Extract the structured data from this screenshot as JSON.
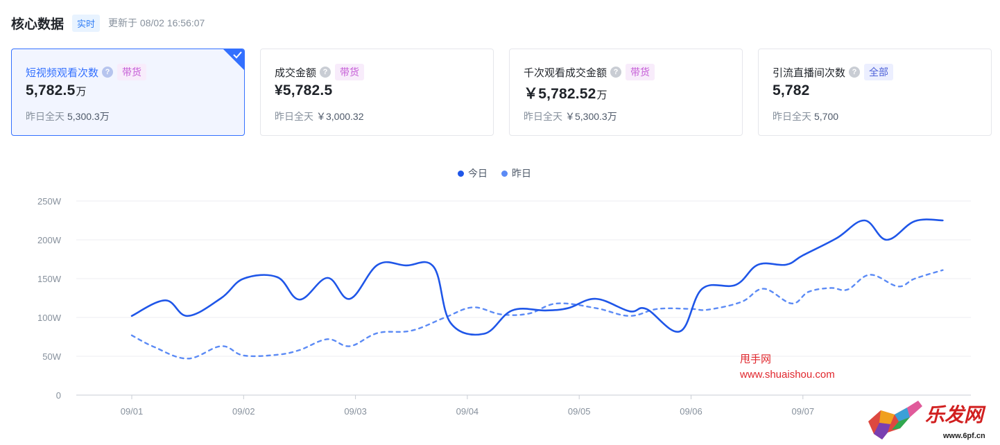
{
  "header": {
    "title": "核心数据",
    "realtime_badge": "实时",
    "update_text": "更新于 08/02 16:56:07"
  },
  "cards": [
    {
      "label": "短视频观看次数",
      "tag": "带货",
      "value": "5,782.5",
      "unit": "万",
      "compare_label": "昨日全天",
      "compare_value": "5,300.3万",
      "selected": true
    },
    {
      "label": "成交金额",
      "tag": "带货",
      "value": "¥5,782.5",
      "unit": "",
      "compare_label": "昨日全天",
      "compare_value": "￥3,000.32",
      "selected": false
    },
    {
      "label": "千次观看成交金额",
      "tag": "带货",
      "value": "￥5,782.52",
      "unit": "万",
      "compare_label": "昨日全天",
      "compare_value": "￥5,300.3万",
      "selected": false
    },
    {
      "label": "引流直播间次数",
      "tag": "全部",
      "value": "5,782",
      "unit": "",
      "compare_label": "昨日全天",
      "compare_value": "5,700",
      "selected": false
    }
  ],
  "legend": {
    "today": "今日",
    "yesterday": "昨日"
  },
  "colors": {
    "today": "#1f56e8",
    "yesterday": "#5b8af5",
    "selected_border": "#3370ff",
    "grid": "#e5e6eb"
  },
  "icons": {
    "help": "question-circle-icon",
    "check": "check-icon"
  },
  "chart_data": {
    "type": "line",
    "x_ticks": [
      "09/01",
      "09/02",
      "09/03",
      "09/04",
      "09/05",
      "09/06",
      "09/07"
    ],
    "y_ticks": [
      "0",
      "50W",
      "100W",
      "150W",
      "200W",
      "250W"
    ],
    "ylim": [
      0,
      250
    ],
    "series": [
      {
        "name": "今日",
        "style": "solid",
        "values": [
          [
            1.0,
            102
          ],
          [
            1.3,
            122
          ],
          [
            1.5,
            102
          ],
          [
            1.8,
            125
          ],
          [
            2.0,
            150
          ],
          [
            2.3,
            152
          ],
          [
            2.5,
            123
          ],
          [
            2.75,
            151
          ],
          [
            2.95,
            124
          ],
          [
            3.2,
            168
          ],
          [
            3.45,
            167
          ],
          [
            3.7,
            165
          ],
          [
            3.85,
            93
          ],
          [
            4.15,
            79
          ],
          [
            4.4,
            109
          ],
          [
            4.7,
            109
          ],
          [
            4.9,
            112
          ],
          [
            5.15,
            124
          ],
          [
            5.45,
            108
          ],
          [
            5.6,
            111
          ],
          [
            5.9,
            82
          ],
          [
            6.1,
            137
          ],
          [
            6.4,
            142
          ],
          [
            6.6,
            168
          ],
          [
            6.85,
            168
          ],
          [
            7.0,
            180
          ],
          [
            7.3,
            202
          ],
          [
            7.55,
            225
          ],
          [
            7.75,
            200
          ],
          [
            8.0,
            224
          ],
          [
            8.25,
            225
          ]
        ]
      },
      {
        "name": "昨日",
        "style": "dashed",
        "values": [
          [
            1.0,
            77
          ],
          [
            1.2,
            62
          ],
          [
            1.5,
            47
          ],
          [
            1.8,
            63
          ],
          [
            2.0,
            51
          ],
          [
            2.3,
            52
          ],
          [
            2.5,
            58
          ],
          [
            2.75,
            72
          ],
          [
            2.95,
            63
          ],
          [
            3.2,
            80
          ],
          [
            3.5,
            83
          ],
          [
            3.8,
            100
          ],
          [
            4.05,
            113
          ],
          [
            4.3,
            104
          ],
          [
            4.55,
            105
          ],
          [
            4.8,
            118
          ],
          [
            5.15,
            112
          ],
          [
            5.45,
            102
          ],
          [
            5.7,
            111
          ],
          [
            6.0,
            111
          ],
          [
            6.15,
            110
          ],
          [
            6.45,
            120
          ],
          [
            6.65,
            137
          ],
          [
            6.9,
            118
          ],
          [
            7.05,
            133
          ],
          [
            7.25,
            138
          ],
          [
            7.4,
            136
          ],
          [
            7.6,
            155
          ],
          [
            7.85,
            140
          ],
          [
            8.0,
            150
          ],
          [
            8.25,
            161
          ]
        ]
      }
    ]
  },
  "watermark": {
    "line1": "甩手网",
    "line2": "www.shuaishou.com"
  },
  "logo": {
    "text": "乐发网",
    "url": "www.6pf.cn"
  }
}
